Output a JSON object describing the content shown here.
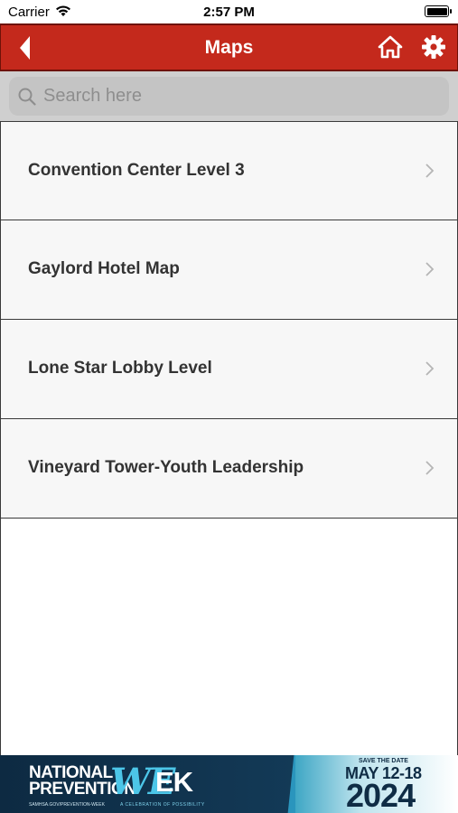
{
  "status_bar": {
    "carrier": "Carrier",
    "time": "2:57 PM"
  },
  "nav": {
    "title": "Maps",
    "bg_color": "#c4291c"
  },
  "search": {
    "placeholder": "Search here",
    "value": ""
  },
  "maps": [
    {
      "label": "Convention Center Level 3"
    },
    {
      "label": "Gaylord Hotel Map"
    },
    {
      "label": "Lone Star Lobby Level"
    },
    {
      "label": "Vineyard Tower-Youth Leadership"
    }
  ],
  "banner": {
    "line1": "NATIONAL",
    "line2": "PREVENTION",
    "we": "WE",
    "ek": "EK",
    "url": "SAMHSA.GOV/PREVENTION-WEEK",
    "tagline": "A CELEBRATION OF POSSIBILITY",
    "save_the_date": "SAVE THE DATE",
    "dates": "MAY 12-18",
    "year": "2024"
  },
  "icons": {
    "back": "back-arrow-icon",
    "home": "home-icon",
    "settings": "gear-icon",
    "search": "search-icon",
    "row": "chevron-right-icon"
  }
}
